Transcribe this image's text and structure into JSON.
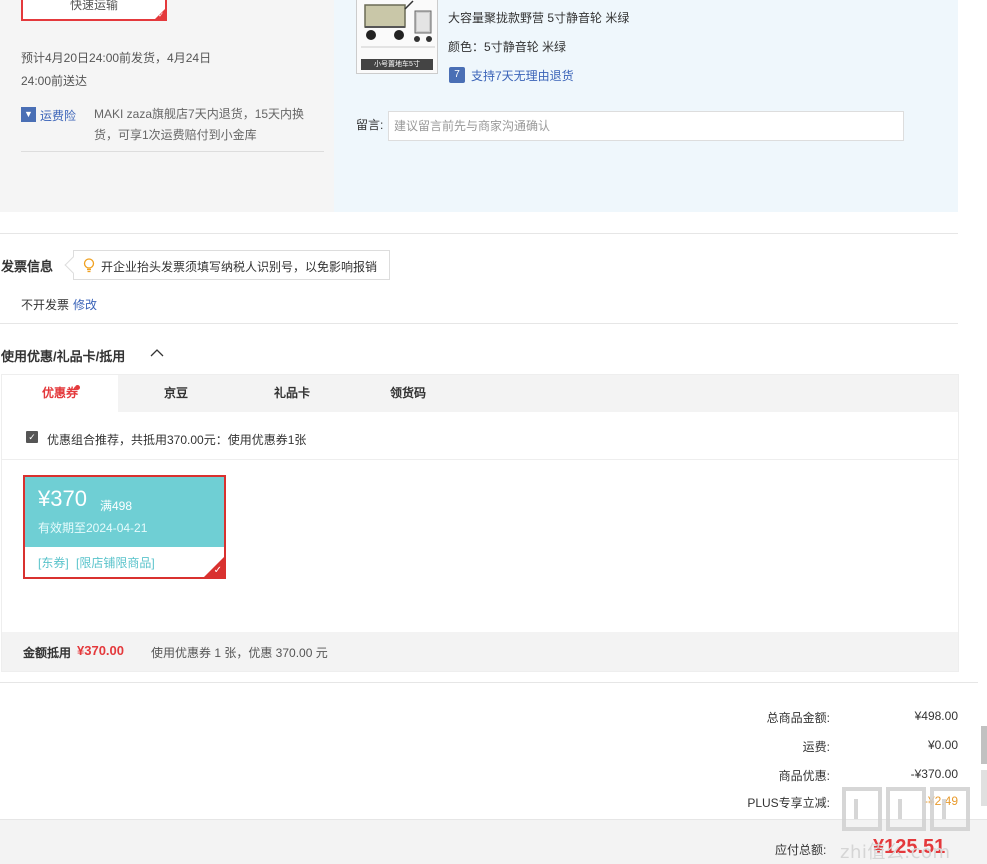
{
  "shipping": {
    "method_label": "快速运输",
    "delivery_text": "预计4月20日24:00前发货，4月24日24:00前送达",
    "insurance_link": "运费险",
    "insurance_desc": "MAKI zaza旗舰店7天内退货，15天内换货，可享1次运费赔付到小金库"
  },
  "product": {
    "image_caption": "小号置地车5寸",
    "title": "大容量聚拢款野营 5寸静音轮 米绿",
    "color_label": "颜色：",
    "color_value": "5寸静音轮 米绿",
    "return_icon_text": "7",
    "return_policy": "支持7天无理由退货"
  },
  "message": {
    "label": "留言:",
    "placeholder": "建议留言前先与商家沟通确认"
  },
  "invoice": {
    "title": "发票信息",
    "tip": "开企业抬头发票须填写纳税人识别号，以免影响报销",
    "value": "不开发票",
    "edit": "修改"
  },
  "coupons": {
    "title": "使用优惠/礼品卡/抵用",
    "tabs": [
      {
        "label": "优惠券",
        "active": true,
        "dot": true
      },
      {
        "label": "京豆",
        "active": false
      },
      {
        "label": "礼品卡",
        "active": false
      },
      {
        "label": "领货码",
        "active": false
      }
    ],
    "combo_text": "优惠组合推荐，共抵用370.00元：使用优惠券1张",
    "combo_checked": true,
    "coupon": {
      "amount": "¥370",
      "condition": "满498",
      "valid_until": "有效期至2024-04-21",
      "tags": [
        "[东券]",
        "[限店铺限商品]"
      ],
      "selected": true
    },
    "footer_label": "金额抵用",
    "footer_amount": "¥370.00",
    "footer_desc": "使用优惠券 1 张，优惠 370.00 元"
  },
  "summary": {
    "rows": [
      {
        "label": "总商品金额:",
        "value": "¥498.00"
      },
      {
        "label": "运费:",
        "value": "¥0.00"
      },
      {
        "label": "商品优惠:",
        "value": "-¥370.00"
      },
      {
        "label": "PLUS专享立减:",
        "value": "-¥2.49"
      }
    ],
    "payable_label": "应付总额:",
    "payable_value": "¥125.51"
  },
  "watermark": "zhi值么.com",
  "colors": {
    "accent_red": "#e4393c",
    "link_blue": "#3a63b8",
    "coupon_teal": "#6fcfd4"
  }
}
